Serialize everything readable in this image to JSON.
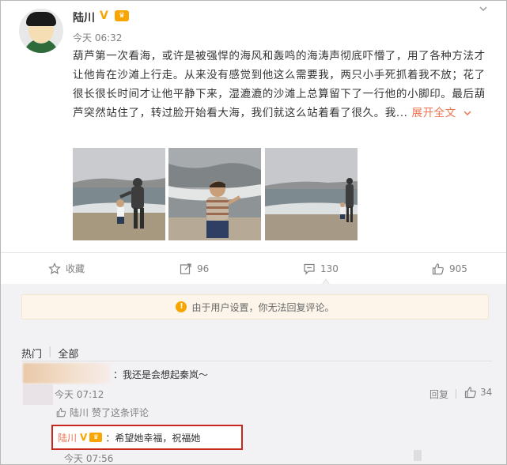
{
  "post": {
    "username": "陆川",
    "verified_mark": "V",
    "member_badge": "♛",
    "time": "今天 06:32",
    "text": "葫芦第一次看海，或许是被强悍的海风和轰鸣的海涛声彻底吓懵了，用了各种方法才让他肯在沙滩上行走。从来没有感觉到他这么需要我，两只小手死抓着我不放；花了很长很长时间才让他平静下来，湿漉漉的沙滩上总算留下了一行他的小脚印。最后葫芦突然站住了，转过脸开始看大海，我们就这么站着看了很久。我...",
    "expand_label": "展开全文",
    "expand_icon": "chevron-down-icon",
    "menu_icon": "chevron-down-icon"
  },
  "actions": {
    "favorite_label": "收藏",
    "forward_count": "96",
    "comment_count": "130",
    "like_count": "905"
  },
  "comments": {
    "notice": "由于用户设置，你无法回复评论。",
    "tab_hot": "热门",
    "tab_separator": "|",
    "tab_all": "全部",
    "first": {
      "text": "：我还是会想起秦岚～",
      "time": "今天 07:12",
      "reply_label": "回复",
      "like_count": "34",
      "liked_by_name": "陆川",
      "liked_by_text": "赞了这条评论"
    },
    "reply": {
      "name": "陆川",
      "verified_mark": "V",
      "member_badge": "♛",
      "text": "：希望她幸福，祝福她",
      "time": "今天 07:56"
    }
  },
  "colors": {
    "accent": "#eb7350",
    "verified": "#f7a500",
    "highlight_border": "#c7271c",
    "notice_bg": "#fdf5ea"
  }
}
